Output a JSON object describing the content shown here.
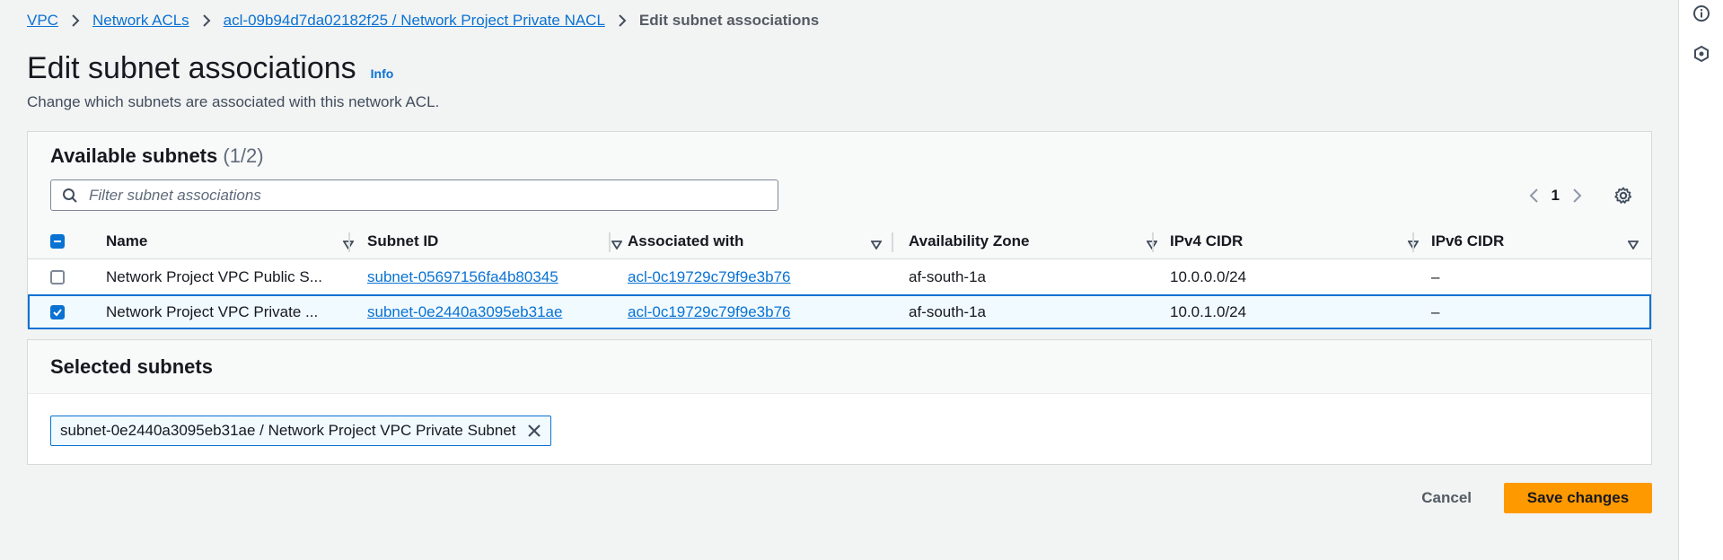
{
  "breadcrumbs": {
    "items": [
      "VPC",
      "Network ACLs",
      "acl-09b94d7da02182f25 / Network Project Private NACL"
    ],
    "current": "Edit subnet associations"
  },
  "page": {
    "title": "Edit subnet associations",
    "info": "Info",
    "description": "Change which subnets are associated with this network ACL."
  },
  "available": {
    "heading": "Available subnets",
    "count": "(1/2)",
    "filter_placeholder": "Filter subnet associations",
    "page_number": "1",
    "columns": [
      "Name",
      "Subnet ID",
      "Associated with",
      "Availability Zone",
      "IPv4 CIDR",
      "IPv6 CIDR"
    ],
    "rows": [
      {
        "selected": false,
        "name": "Network Project VPC Public S...",
        "subnet_id": "subnet-05697156fa4b80345",
        "associated_with": "acl-0c19729c79f9e3b76",
        "az": "af-south-1a",
        "ipv4": "10.0.0.0/24",
        "ipv6": "–"
      },
      {
        "selected": true,
        "name": "Network Project VPC Private ...",
        "subnet_id": "subnet-0e2440a3095eb31ae",
        "associated_with": "acl-0c19729c79f9e3b76",
        "az": "af-south-1a",
        "ipv4": "10.0.1.0/24",
        "ipv6": "–"
      }
    ]
  },
  "selected": {
    "heading": "Selected subnets",
    "tokens": [
      "subnet-0e2440a3095eb31ae / Network Project VPC Private Subnet"
    ]
  },
  "actions": {
    "cancel": "Cancel",
    "save": "Save changes"
  },
  "colors": {
    "link": "#0972d3",
    "primary_button": "#ff9900",
    "selection_border": "#0972d3",
    "selection_bg": "#f1faff"
  },
  "icons": [
    "info-icon",
    "hexagon-icon",
    "chevron-right-icon",
    "search-icon",
    "chevron-left-icon",
    "gear-icon",
    "sort-icon",
    "close-icon"
  ]
}
